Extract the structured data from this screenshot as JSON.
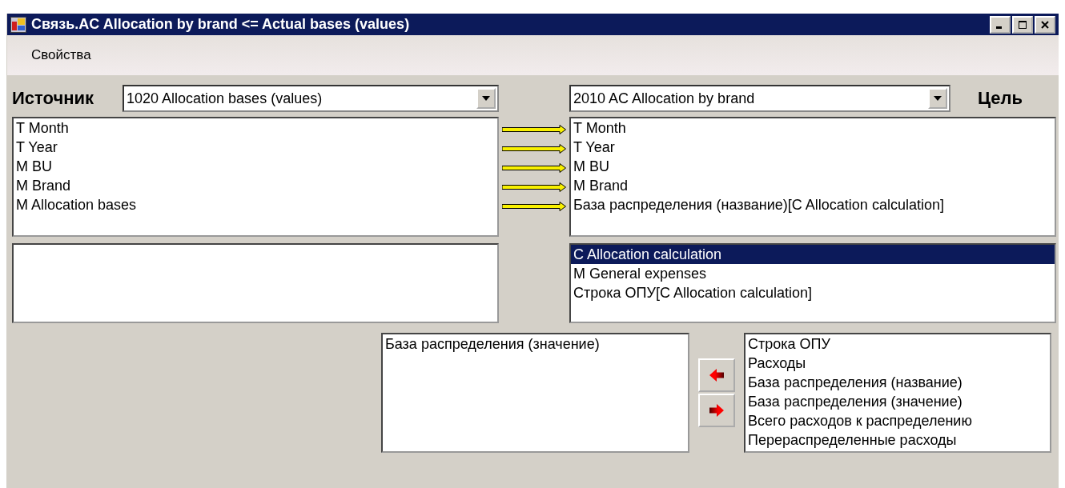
{
  "window": {
    "title": "Связь.AC Allocation by brand <= Actual bases (values)"
  },
  "menu": [
    {
      "label": "Свойства"
    }
  ],
  "source": {
    "label": "Источник",
    "combo": "1020 Allocation bases (values)",
    "fields": [
      {
        "label": "T Month",
        "linked": true
      },
      {
        "label": "T Year",
        "linked": true
      },
      {
        "label": "M BU",
        "linked": true
      },
      {
        "label": "M Brand",
        "linked": true
      },
      {
        "label": "M Allocation bases",
        "linked": true
      }
    ]
  },
  "target": {
    "label": "Цель",
    "combo": "2010 AC Allocation by brand",
    "fields": [
      {
        "label": "T Month"
      },
      {
        "label": "T Year"
      },
      {
        "label": "M BU"
      },
      {
        "label": "M Brand"
      },
      {
        "label": "База распределения (название)[C Allocation calculation]"
      }
    ],
    "objects": [
      {
        "label": "C Allocation calculation",
        "selected": true
      },
      {
        "label": "M General expenses",
        "selected": false
      },
      {
        "label": "Строка ОПУ[C Allocation calculation]",
        "selected": false
      }
    ]
  },
  "chosen_values": [
    {
      "label": "База распределения (значение)"
    }
  ],
  "move_buttons": [
    {
      "kind": "left"
    },
    {
      "kind": "right"
    }
  ],
  "available_values": [
    {
      "label": "Строка ОПУ"
    },
    {
      "label": "Расходы"
    },
    {
      "label": "База распределения (название)"
    },
    {
      "label": "База распределения (значение)"
    },
    {
      "label": "Всего расходов к распределению"
    },
    {
      "label": "Перераспределенные расходы"
    }
  ]
}
